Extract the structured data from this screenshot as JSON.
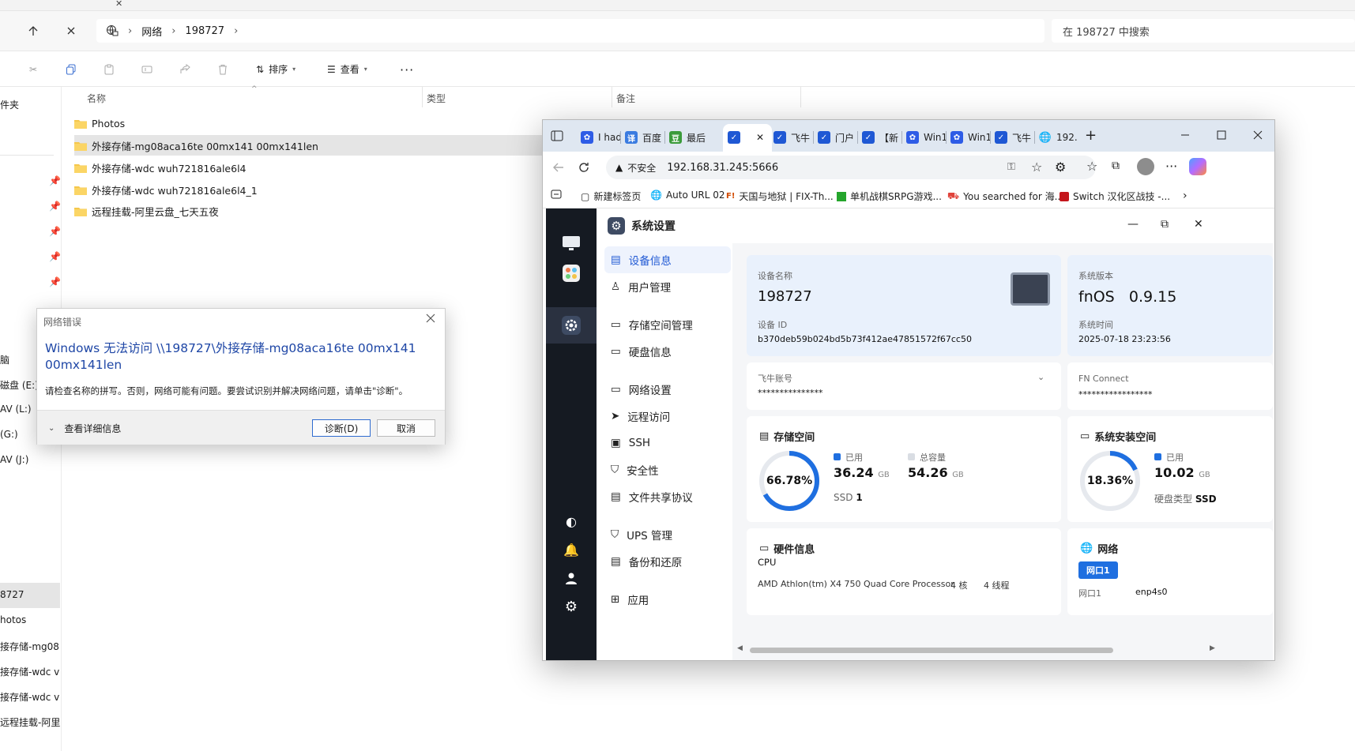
{
  "explorer": {
    "address": {
      "segment1": "网络",
      "segment2": "198727"
    },
    "search_placeholder": "在 198727 中搜索",
    "toolbar": {
      "sort": "排序",
      "view": "查看"
    },
    "columns": {
      "name": "名称",
      "type": "类型",
      "note": "备注"
    },
    "files": [
      "Photos",
      "外接存储-mg08aca16te 00mx141 00mx141len",
      "外接存储-wdc wuh721816ale6l4",
      "外接存储-wdc wuh721816ale6l4_1",
      "远程挂载-阿里云盘_七天五夜"
    ],
    "sidebar": [
      "件夹",
      "脑",
      "磁盘 (E:)",
      "AV (L:)",
      "(G:)",
      "AV (J:)",
      "8727",
      "hotos",
      "接存储-mg08",
      "接存储-wdc v",
      "接存储-wdc v",
      "远程挂载-阿里云"
    ]
  },
  "dialog": {
    "title": "网络错误",
    "heading": "Windows 无法访问 \\\\198727\\外接存储-mg08aca16te 00mx141 00mx141len",
    "body": "请检查名称的拼写。否则，网络可能有问题。要尝试识别并解决网络问题，请单击\"诊断\"。",
    "details": "查看详细信息",
    "diagnose": "诊断(D)",
    "cancel": "取消"
  },
  "browser": {
    "tabs": [
      "I had",
      "百度",
      "最后",
      "",
      "飞牛",
      "门户",
      "【新",
      "Win1",
      "Win1",
      "飞牛",
      "192.1"
    ],
    "security": "不安全",
    "url": "192.168.31.245:5666",
    "bookmarks": [
      "新建标签页",
      "Auto URL 02",
      "天国与地狱 | FIX-Th...",
      "单机战棋SRPG游戏...",
      "You searched for 海...",
      "Switch 汉化区战技 -..."
    ]
  },
  "fnos": {
    "title": "系统设置",
    "nav": [
      "设备信息",
      "用户管理",
      "存储空间管理",
      "硬盘信息",
      "网络设置",
      "远程访问",
      "SSH",
      "安全性",
      "文件共享协议",
      "UPS 管理",
      "备份和还原",
      "应用"
    ],
    "device": {
      "name_label": "设备名称",
      "name": "198727",
      "id_label": "设备 ID",
      "id": "b370deb59b024bd5b73f412ae47851572f67cc50",
      "version_label": "系统版本",
      "version": "fnOS   0.9.15",
      "time_label": "系统时间",
      "time": "2025-07-18 23:23:56"
    },
    "account": {
      "label": "飞牛账号",
      "value": "***************"
    },
    "fnconnect": {
      "label": "FN Connect",
      "value": "*****************"
    },
    "storage": {
      "title": "存储空间",
      "percent": "66.78%",
      "ratio": 0.6678,
      "used_label": "已用",
      "used": "36.24",
      "used_unit": "GB",
      "total_label": "总容量",
      "total": "54.26",
      "total_unit": "GB",
      "ssd_label": "SSD",
      "ssd_count": "1"
    },
    "sysinstall": {
      "title": "系统安装空间",
      "percent": "18.36%",
      "ratio": 0.1836,
      "used_label": "已用",
      "used": "10.02",
      "used_unit": "GB",
      "disk_type_label": "硬盘类型",
      "disk_type": "SSD"
    },
    "hardware": {
      "title": "硬件信息",
      "cpu_label": "CPU",
      "cpu": "AMD Athlon(tm) X4 750 Quad Core Processor",
      "cores": "4 核",
      "threads": "4 线程"
    },
    "network": {
      "title": "网络",
      "port_tab": "网口1",
      "port_label": "网口1",
      "port": "enp4s0"
    }
  },
  "colors": {
    "accent": "#1f58d4",
    "link_blue": "#1f47a6",
    "dock": "#151a22"
  }
}
